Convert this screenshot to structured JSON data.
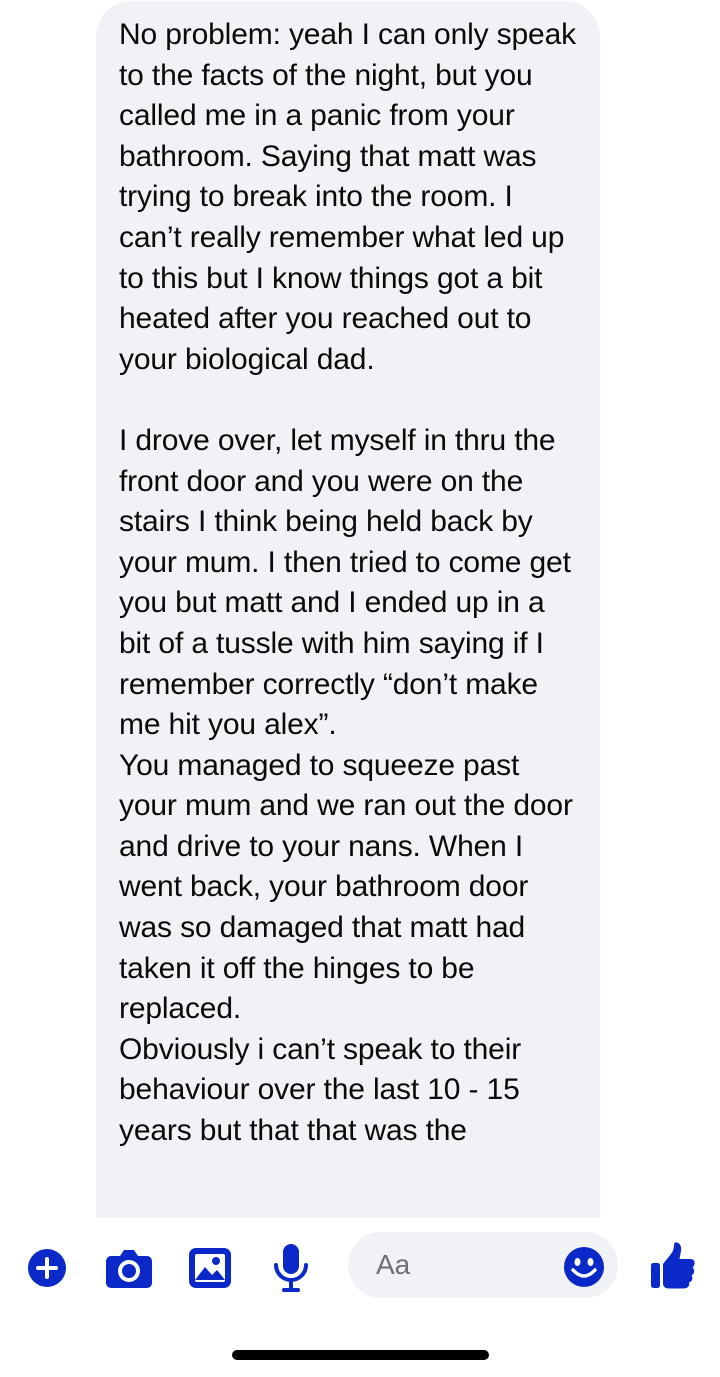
{
  "message": {
    "paragraphs": [
      "No problem: yeah I can only speak to the facts of the night, but you called me in a panic from your bathroom. Saying that matt was trying to break into the room. I can’t really remember what led up to this but I know things got a bit heated after you reached out to your biological dad.",
      "",
      "I drove over, let myself in thru the front door and you were on the stairs I think being held back by your mum. I then tried to come get you but matt and I ended up in a bit of a tussle with him saying if I remember correctly “don’t make me hit you alex”.",
      "You managed to squeeze past your mum and we ran out the door and drive to your nans. When I went back, your bathroom door was so damaged that matt had taken it off the hinges to be replaced.",
      "Obviously i can’t speak to their behaviour over the last 10 - 15 years but that that was the"
    ]
  },
  "composer": {
    "placeholder": "Aa",
    "icons": [
      "plus-icon",
      "camera-icon",
      "photo-icon",
      "microphone-icon",
      "emoji-icon",
      "thumbs-up-icon"
    ],
    "accent_color": "#0a29c8"
  }
}
